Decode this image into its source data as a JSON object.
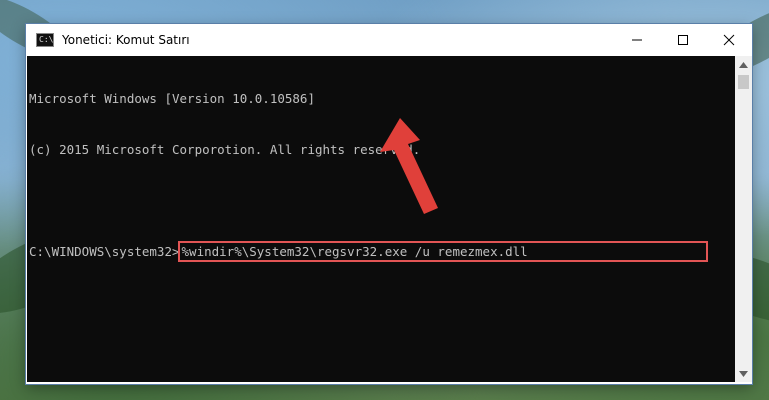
{
  "window": {
    "title": "Yonetici: Komut Satırı",
    "icon": "cmd-icon",
    "controls": [
      "minimize-icon",
      "maximize-icon",
      "close-icon"
    ]
  },
  "console": {
    "lines": [
      "Microsoft Windows [Version 10.0.10586]",
      "(c) 2015 Microsoft Corporotion. All rights reserved."
    ],
    "prompt": "C:\\WINDOWS\\system32>",
    "command": "%windir%\\System32\\regsvr32.exe /u remezmex.dll"
  },
  "colors": {
    "highlight": "#e25555",
    "arrow": "#e0403a",
    "console_bg": "#0c0c0c",
    "console_text": "#c0c0c0"
  }
}
